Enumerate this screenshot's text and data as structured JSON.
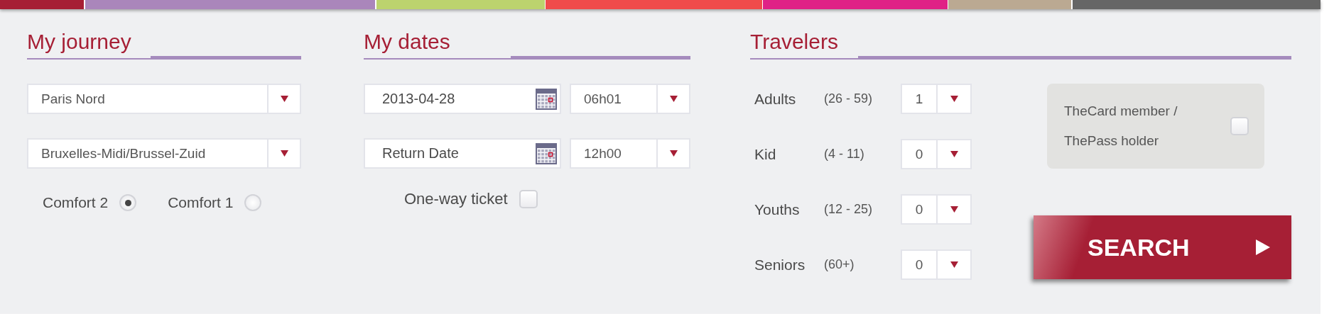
{
  "journey": {
    "title": "My journey",
    "from": {
      "value": "Paris Nord"
    },
    "to": {
      "value": "Bruxelles-Midi/Brussel-Zuid"
    },
    "comfort": [
      {
        "label": "Comfort 2",
        "selected": true
      },
      {
        "label": "Comfort 1",
        "selected": false
      }
    ]
  },
  "dates": {
    "title": "My dates",
    "outbound": {
      "date": "2013-04-28",
      "time": "06h01"
    },
    "return": {
      "date": "Return Date",
      "time": "12h00"
    },
    "one_way": {
      "label": "One-way ticket",
      "checked": false
    }
  },
  "travelers": {
    "title": "Travelers",
    "rows": [
      {
        "label": "Adults",
        "ages": "(26 - 59)",
        "count": "1"
      },
      {
        "label": "Kid",
        "ages": "(4 - 11)",
        "count": "0"
      },
      {
        "label": "Youths",
        "ages": "(12 - 25)",
        "count": "0"
      },
      {
        "label": "Seniors",
        "ages": "(60+)",
        "count": "0"
      }
    ],
    "card": {
      "label": "TheCard member / ThePass holder",
      "checked": false
    },
    "search": "SEARCH"
  }
}
